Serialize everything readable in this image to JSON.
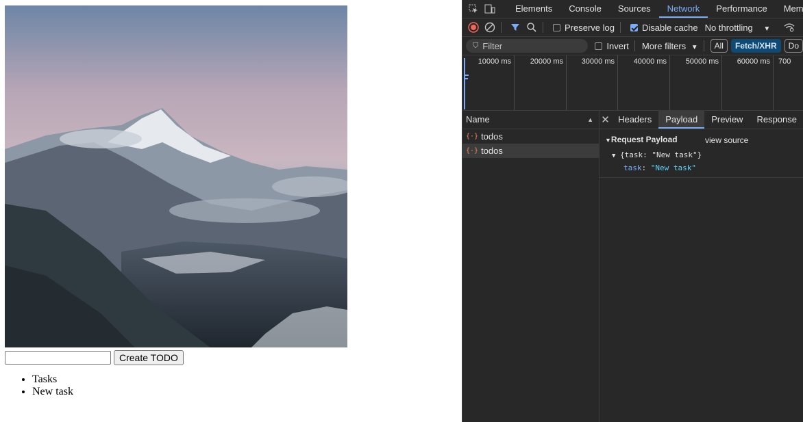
{
  "page": {
    "image_alt": "Snowy mountain landscape",
    "create_button": "Create TODO",
    "input_value": "",
    "list_items": [
      "Tasks",
      "New task"
    ]
  },
  "devtools": {
    "tabs": [
      "Elements",
      "Console",
      "Sources",
      "Network",
      "Performance",
      "Memo"
    ],
    "active_tab": "Network",
    "toolbar": {
      "preserve_log": "Preserve log",
      "disable_cache": "Disable cache",
      "throttling": "No throttling"
    },
    "filter": {
      "placeholder": "Filter",
      "invert": "Invert",
      "more_filters": "More filters",
      "pills": [
        "All",
        "Fetch/XHR",
        "Do"
      ]
    },
    "timeline_ticks": [
      "10000 ms",
      "20000 ms",
      "30000 ms",
      "40000 ms",
      "50000 ms",
      "60000 ms",
      "700"
    ],
    "name_header": "Name",
    "requests": [
      "todos",
      "todos"
    ],
    "detail_tabs": [
      "Headers",
      "Payload",
      "Preview",
      "Response"
    ],
    "payload": {
      "title": "Request Payload",
      "view_source": "view source",
      "object": "{task: \"New task\"}",
      "key": "task",
      "value": "\"New task\""
    },
    "colors": {
      "accent": "#7cacf8",
      "background": "#282828",
      "record_red": "#ee675c"
    }
  }
}
